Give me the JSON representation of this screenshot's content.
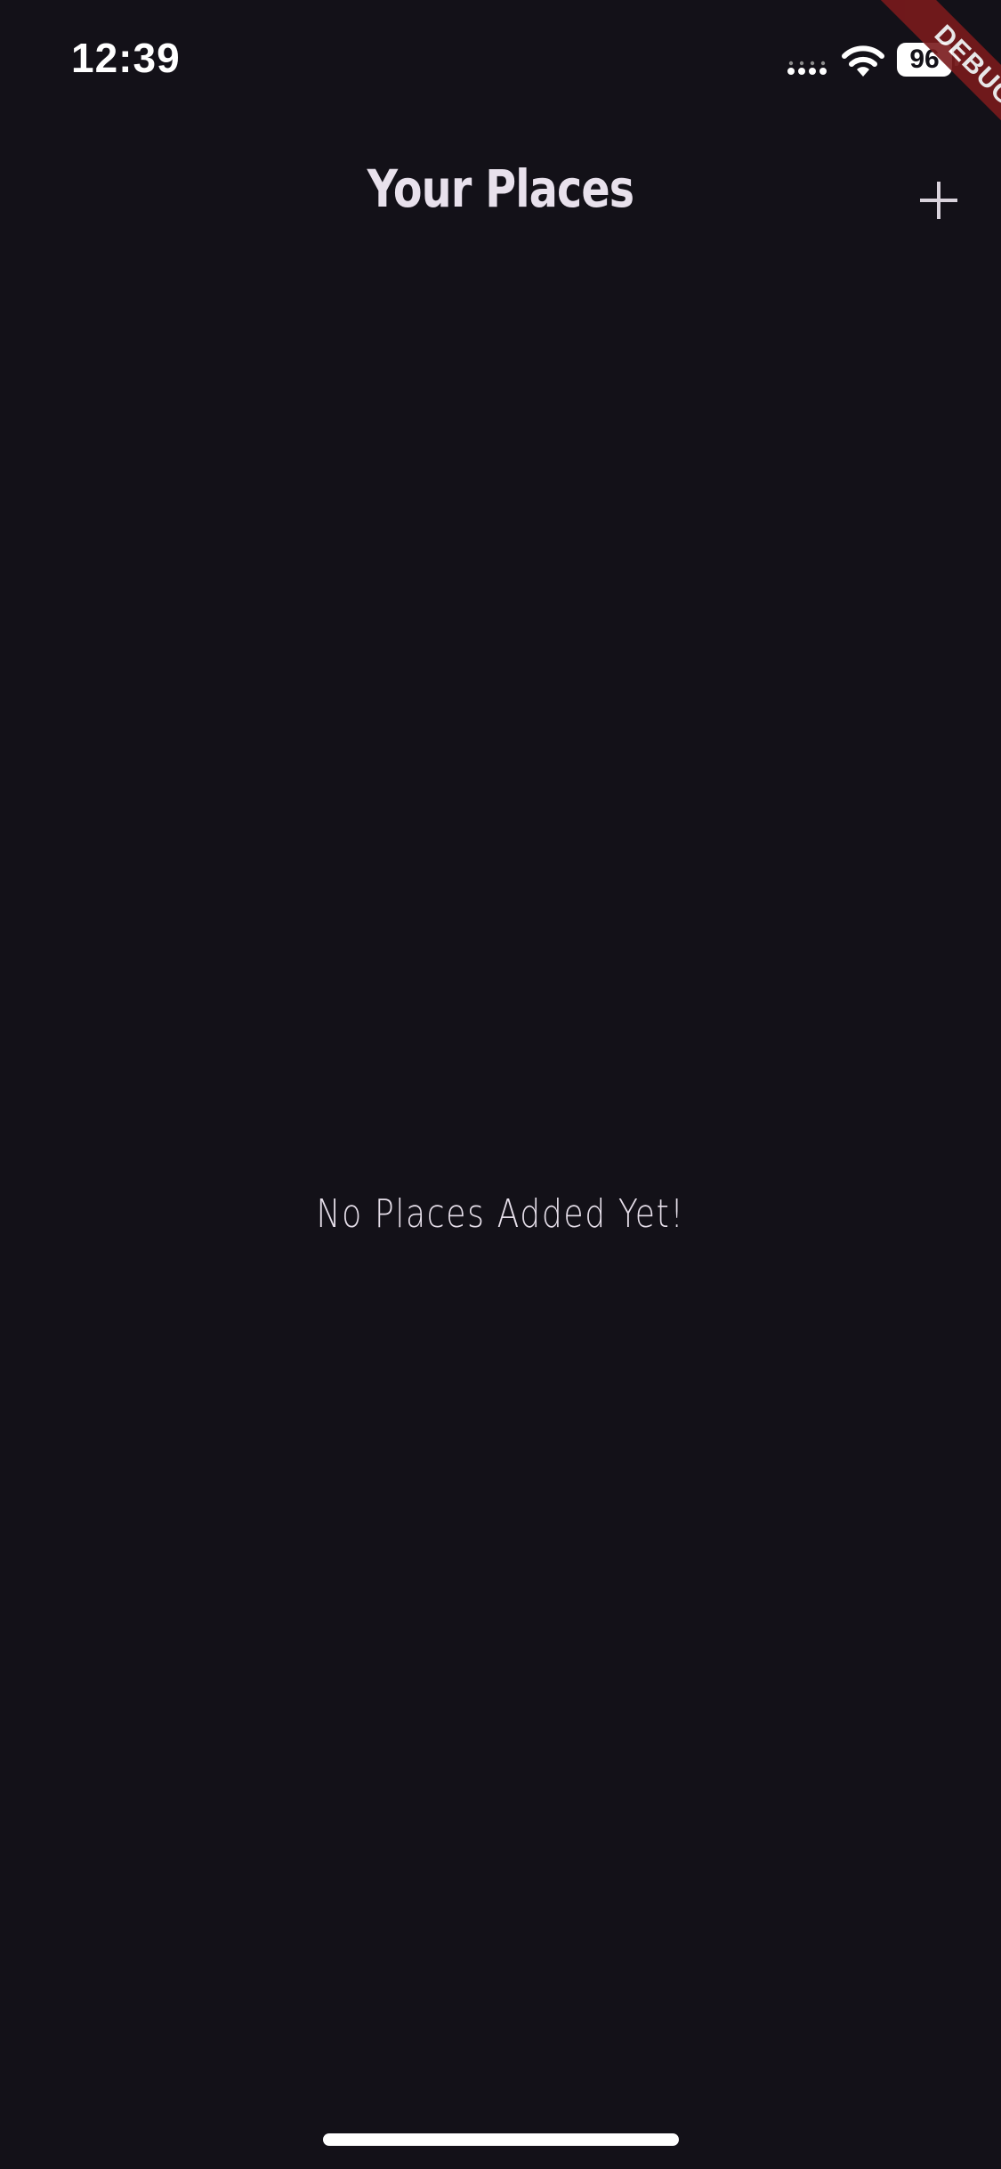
{
  "status_bar": {
    "time": "12:39",
    "battery_level": "96",
    "icons": [
      "signal-icon",
      "wifi-icon",
      "battery-icon"
    ]
  },
  "debug_banner": {
    "label": "DEBUG",
    "color": "#7a1a1c"
  },
  "app_bar": {
    "title": "Your Places",
    "add_icon": "plus-icon"
  },
  "main": {
    "empty_message": "No Places Added Yet!"
  },
  "colors": {
    "background": "#131118",
    "text": "#e8e1ec"
  }
}
